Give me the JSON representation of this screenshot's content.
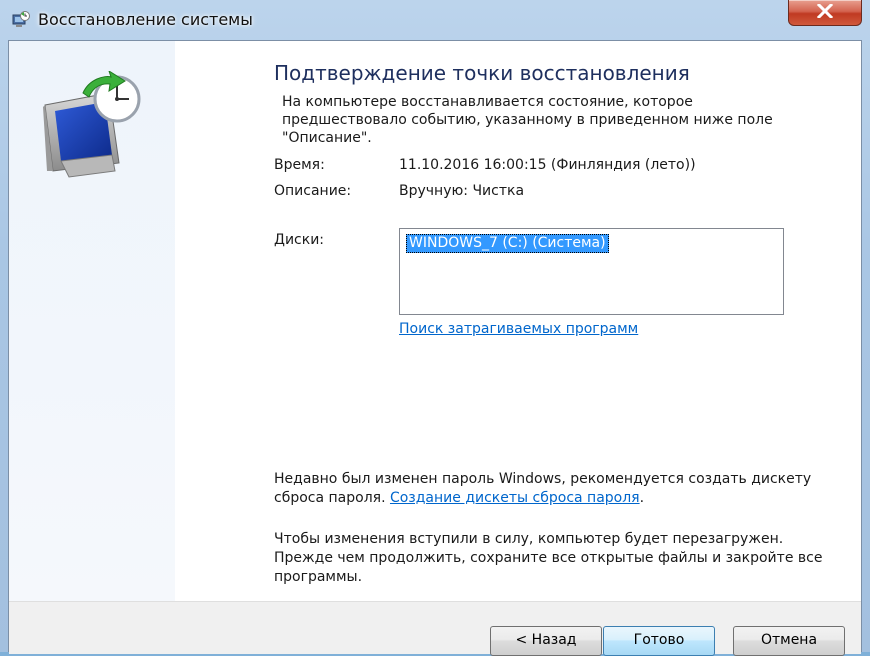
{
  "window": {
    "title": "Восстановление системы",
    "close_label": "×"
  },
  "content": {
    "heading": "Подтверждение точки восстановления",
    "intro": "На компьютере восстанавливается состояние, которое предшествовало событию, указанному в приведенном ниже поле \"Описание\".",
    "time_label": "Время:",
    "time_value": "11.10.2016 16:00:15 (Финляндия (лето))",
    "description_label": "Описание:",
    "description_value": "Вручную: Чистка",
    "disks_label": "Диски:",
    "disks": [
      "WINDOWS_7 (C:) (Система)"
    ],
    "affected_link": "Поиск затрагиваемых программ",
    "password_note": "Недавно был изменен пароль Windows, рекомендуется создать дискету сброса пароля. ",
    "password_link": "Создание дискеты сброса пароля",
    "password_note_end": ".",
    "reboot_note": "Чтобы изменения вступили в силу, компьютер будет перезагружен. Прежде чем продолжить, сохраните все открытые файлы и закройте все программы."
  },
  "buttons": {
    "back": "< Назад",
    "finish": "Готово",
    "cancel": "Отмена"
  },
  "colors": {
    "link": "#0066cc",
    "selection": "#3399ff",
    "heading": "#1e2f5e"
  },
  "icons": {
    "app": "system-restore-icon",
    "graphic": "monitor-clock-restore-icon",
    "close": "close-icon"
  }
}
